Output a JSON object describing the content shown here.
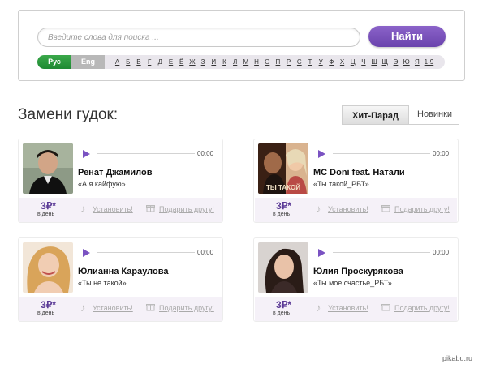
{
  "search": {
    "placeholder": "Введите слова для поиска ...",
    "button_label": "Найти"
  },
  "alphabet": {
    "lang_rus": "Рус",
    "lang_eng": "Eng",
    "letters": [
      "А",
      "Б",
      "В",
      "Г",
      "Д",
      "Е",
      "Ё",
      "Ж",
      "З",
      "И",
      "К",
      "Л",
      "М",
      "Н",
      "О",
      "П",
      "Р",
      "С",
      "Т",
      "У",
      "Ф",
      "Х",
      "Ц",
      "Ч",
      "Ш",
      "Щ",
      "Э",
      "Ю",
      "Я",
      "1-9"
    ]
  },
  "section": {
    "title": "Замени гудок:",
    "tab_hit": "Хит-Парад",
    "tab_new": "Новинки"
  },
  "cards": [
    {
      "artist": "Ренат Джамилов",
      "song": "«А я кайфую»",
      "time": "00:00",
      "price": "3₽*",
      "per_day": "в день",
      "install": "Установить!",
      "gift": "Подарить другу!"
    },
    {
      "artist": "MC Doni feat. Натали",
      "song": "«Ты такой_РБТ»",
      "time": "00:00",
      "price": "3₽*",
      "per_day": "в день",
      "install": "Установить!",
      "gift": "Подарить другу!",
      "cover_text": "ТЫ ТАКОЙ"
    },
    {
      "artist": "Юлианна Караулова",
      "song": "«Ты не такой»",
      "time": "00:00",
      "price": "3₽*",
      "per_day": "в день",
      "install": "Установить!",
      "gift": "Подарить другу!"
    },
    {
      "artist": "Юлия Проскурякова",
      "song": "«Ты мое счастье_РБТ»",
      "time": "00:00",
      "price": "3₽*",
      "per_day": "в день",
      "install": "Установить!",
      "gift": "Подарить другу!"
    }
  ],
  "watermark": "pikabu.ru",
  "colors": {
    "accent": "#7a52c2",
    "rus_green": "#2a9a3e",
    "price": "#5b3a96",
    "footer_bg": "#f5f1f8"
  }
}
